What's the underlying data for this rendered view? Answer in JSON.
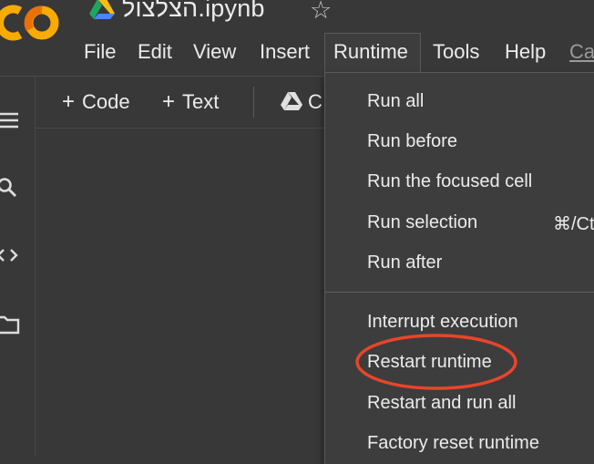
{
  "notebook": {
    "title": "הצלצול.ipynb",
    "logo_text": "CO",
    "star_icon": "star-icon",
    "brand_colors": {
      "logo_orange": "#f9ab00",
      "logo_dark_orange": "#e8710a"
    }
  },
  "menubar": {
    "items": [
      "File",
      "Edit",
      "View",
      "Insert",
      "Runtime",
      "Tools",
      "Help"
    ],
    "partial_item": "Ca",
    "active": "Runtime"
  },
  "toolbar": {
    "code_label": "Code",
    "text_label": "Text",
    "partial_label": "C"
  },
  "side_rail": {
    "icons": [
      "menu-icon",
      "search-icon",
      "code-icon",
      "folder-icon"
    ]
  },
  "runtime_menu": {
    "items": [
      {
        "label": "Run all"
      },
      {
        "label": "Run before"
      },
      {
        "label": "Run the focused cell"
      },
      {
        "label": "Run selection",
        "shortcut": "⌘/Ct"
      },
      {
        "label": "Run after"
      },
      {
        "label": "Interrupt execution"
      },
      {
        "label": "Restart runtime",
        "annotated": true
      },
      {
        "label": "Restart and run all"
      },
      {
        "label": "Factory reset runtime"
      }
    ],
    "annotation_color": "#e8452a"
  }
}
